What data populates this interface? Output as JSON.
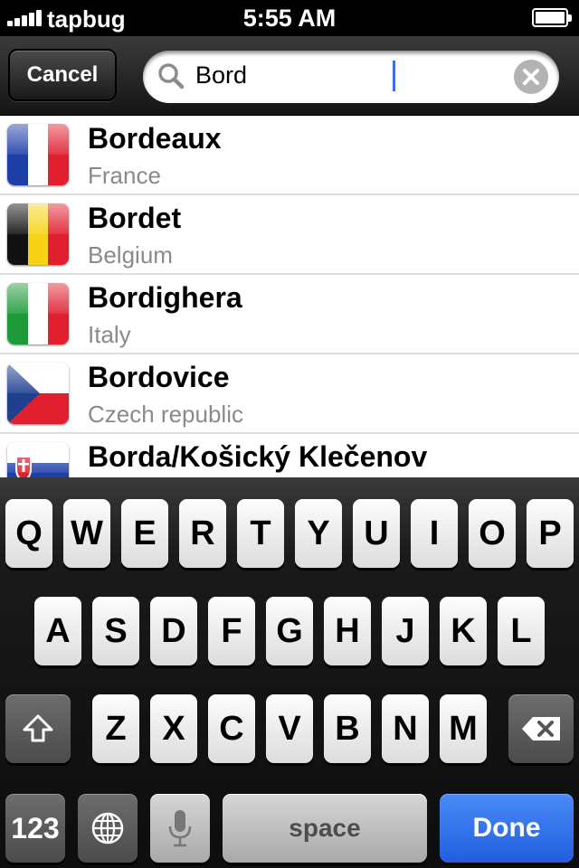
{
  "status_bar": {
    "carrier": "tapbug",
    "time": "5:55 AM"
  },
  "search": {
    "cancel_label": "Cancel",
    "query": "Bord"
  },
  "results": [
    {
      "city": "Bordeaux",
      "country": "France",
      "flag": "france-flag"
    },
    {
      "city": "Bordet",
      "country": "Belgium",
      "flag": "belgium-flag"
    },
    {
      "city": "Bordighera",
      "country": "Italy",
      "flag": "italy-flag"
    },
    {
      "city": "Bordovice",
      "country": "Czech republic",
      "flag": "czech-flag"
    },
    {
      "city": "Borda/Košický Klečenov",
      "country": "",
      "flag": "slovakia-flag"
    }
  ],
  "keyboard": {
    "row1": [
      "Q",
      "W",
      "E",
      "R",
      "T",
      "Y",
      "U",
      "I",
      "O",
      "P"
    ],
    "row2": [
      "A",
      "S",
      "D",
      "F",
      "G",
      "H",
      "J",
      "K",
      "L"
    ],
    "row3": [
      "Z",
      "X",
      "C",
      "V",
      "B",
      "N",
      "M"
    ],
    "numbers_label": "123",
    "space_label": "space",
    "done_label": "Done"
  },
  "colors": {
    "done_blue": "#2a6cf0",
    "caret": "#3d6ee8"
  }
}
